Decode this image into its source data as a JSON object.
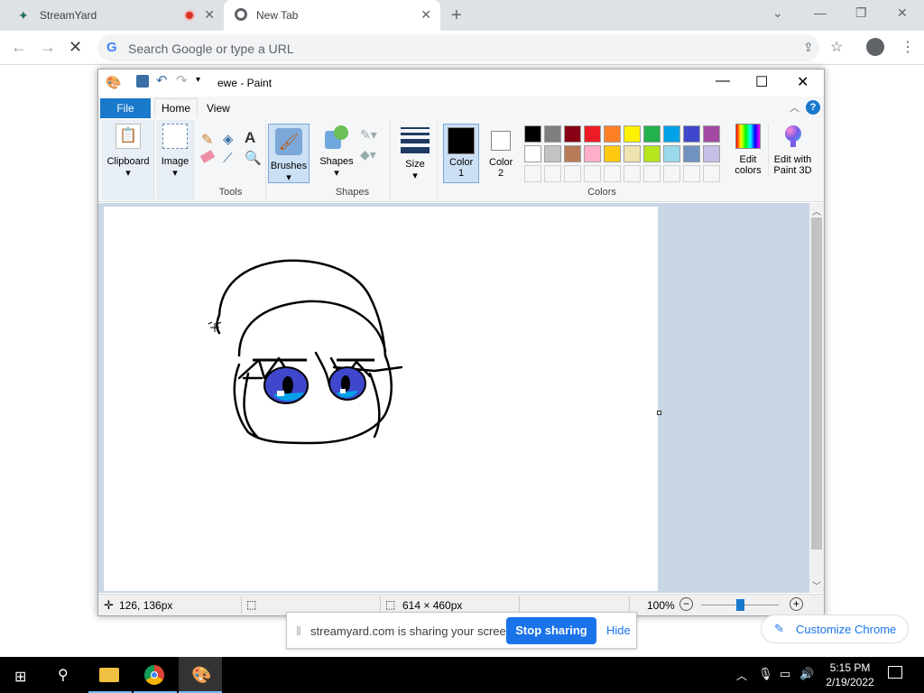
{
  "browser": {
    "tabs": [
      {
        "title": "StreamYard"
      },
      {
        "title": "New Tab"
      }
    ],
    "omnibox_placeholder": "Search Google or type a URL"
  },
  "paint": {
    "title": "ewe - Paint",
    "ribbon_tabs": [
      "File",
      "Home",
      "View"
    ],
    "groups": {
      "clipboard": "Clipboard",
      "image": "Image",
      "tools": "Tools",
      "brushes": "Brushes",
      "shapes_btn": "Shapes",
      "shapes_group": "Shapes",
      "size": "Size",
      "color1": "Color 1",
      "color2": "Color 2",
      "colors": "Colors",
      "edit_colors": "Edit colors",
      "edit_paint3d": "Edit with Paint 3D"
    },
    "palette": {
      "row1": [
        "#000000",
        "#7f7f7f",
        "#880015",
        "#ed1c24",
        "#ff7f27",
        "#fff200",
        "#22b14c",
        "#00a2e8",
        "#3f48cc",
        "#a349a4"
      ],
      "row2": [
        "#ffffff",
        "#c3c3c3",
        "#b97a57",
        "#ffaec9",
        "#ffc90e",
        "#efe4b0",
        "#b5e61d",
        "#99d9ea",
        "#7092be",
        "#c8bfe7"
      ]
    },
    "status": {
      "cursor_pos": "126, 136px",
      "canvas_size": "614 × 460px",
      "zoom": "100%"
    }
  },
  "share_bar": {
    "message": "streamyard.com is sharing your screen.",
    "stop_label": "Stop sharing",
    "hide_label": "Hide"
  },
  "customize_label": "Customize Chrome",
  "taskbar": {
    "time": "5:15 PM",
    "date": "2/19/2022"
  }
}
